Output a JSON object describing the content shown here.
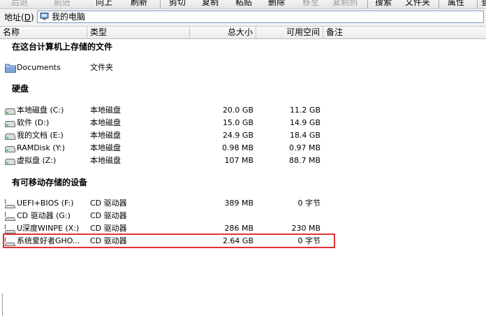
{
  "toolbar": {
    "buttons": [
      {
        "label": "后退",
        "disabled": true
      },
      {
        "label": "前进",
        "disabled": true
      },
      {
        "label": "向上",
        "disabled": false
      },
      {
        "label": "刷新",
        "disabled": false
      },
      {
        "label": "剪切",
        "disabled": false
      },
      {
        "label": "复制",
        "disabled": false
      },
      {
        "label": "粘贴",
        "disabled": false
      },
      {
        "label": "删除",
        "disabled": false
      },
      {
        "label": "移至",
        "disabled": true
      },
      {
        "label": "复制到",
        "disabled": true
      },
      {
        "label": "搜索",
        "disabled": false
      },
      {
        "label": "文件夹",
        "disabled": false
      },
      {
        "label": "属性",
        "disabled": false
      },
      {
        "label": "查看",
        "disabled": false
      }
    ]
  },
  "address": {
    "label": "地址(D)",
    "label_main": "地址(",
    "label_key": "D",
    "label_end": ")",
    "value": "我的电脑"
  },
  "columns": {
    "name": "名称",
    "type": "类型",
    "size": "总大小",
    "free": "可用空间",
    "note": "备注"
  },
  "groups": {
    "files": {
      "title": "在这台计算机上存储的文件",
      "items": [
        {
          "name": "Documents",
          "type": "文件夹",
          "size": "",
          "free": "",
          "icon": "folder-icon"
        }
      ]
    },
    "disks": {
      "title": "硬盘",
      "items": [
        {
          "name": "本地磁盘 (C:)",
          "type": "本地磁盘",
          "size": "20.0 GB",
          "free": "11.2 GB",
          "icon": "hard-drive-icon"
        },
        {
          "name": "软件 (D:)",
          "type": "本地磁盘",
          "size": "15.0 GB",
          "free": "14.9 GB",
          "icon": "hard-drive-icon"
        },
        {
          "name": "我的文档 (E:)",
          "type": "本地磁盘",
          "size": "24.9 GB",
          "free": "18.4 GB",
          "icon": "hard-drive-icon"
        },
        {
          "name": "RAMDisk (Y:)",
          "type": "本地磁盘",
          "size": "0.98 MB",
          "free": "0.97 MB",
          "icon": "hard-drive-icon"
        },
        {
          "name": "虚拟盘 (Z:)",
          "type": "本地磁盘",
          "size": "107 MB",
          "free": "88.7 MB",
          "icon": "hard-drive-icon"
        }
      ]
    },
    "removable": {
      "title": "有可移动存储的设备",
      "items": [
        {
          "name": "UEFI+BIOS (F:)",
          "type": "CD 驱动器",
          "size": "389 MB",
          "free": "0 字节",
          "icon": "cd-drive-icon"
        },
        {
          "name": "CD 驱动器 (G:)",
          "type": "CD 驱动器",
          "size": "",
          "free": "",
          "icon": "cd-drive-icon"
        },
        {
          "name": "U深度WINPE (X:)",
          "type": "CD 驱动器",
          "size": "286 MB",
          "free": "230 MB",
          "icon": "cd-drive-icon"
        },
        {
          "name": "系统爱好者GHO...",
          "type": "CD 驱动器",
          "size": "2.64 GB",
          "free": "0 字节",
          "icon": "cd-drive-icon"
        }
      ]
    }
  },
  "colors": {
    "highlight_border": "#e03232",
    "address_border": "#7a9cc7"
  }
}
